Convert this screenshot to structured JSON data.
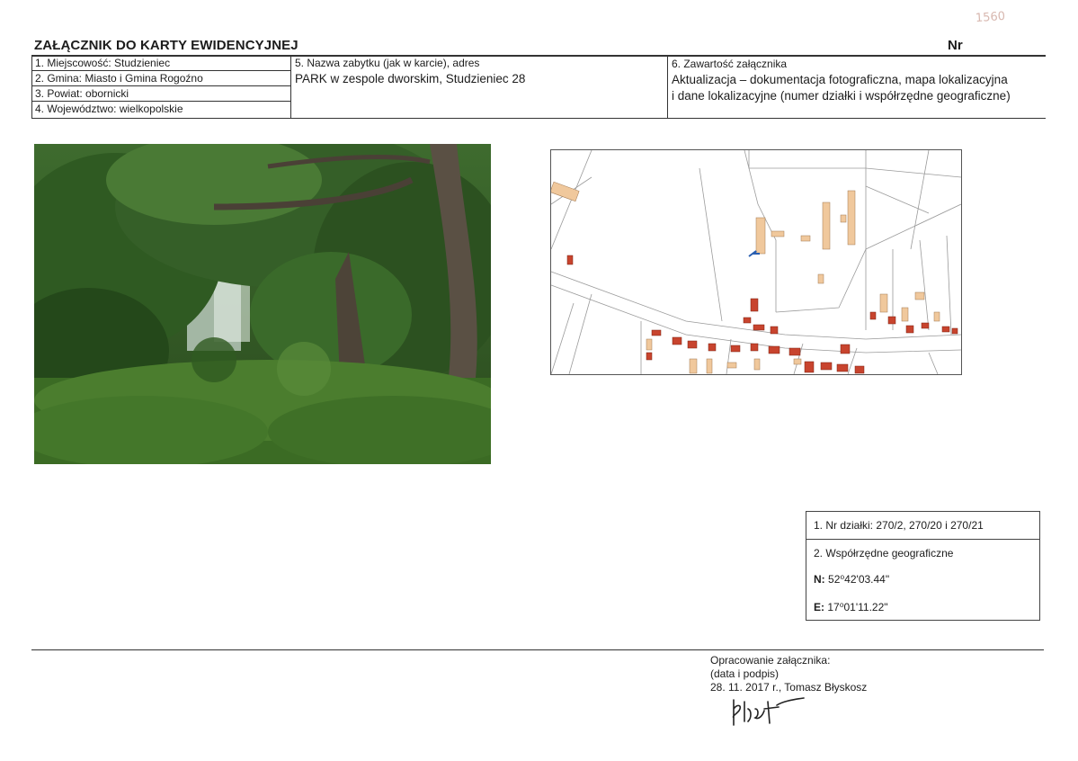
{
  "header": {
    "title": "ZAŁĄCZNIK DO KARTY EWIDENCYJNEJ",
    "nr_label": "Nr",
    "pencil_note": "1560"
  },
  "fields": {
    "miejscowosc": "1. Miejscowość: Studzieniec",
    "gmina": "2. Gmina: Miasto i Gmina Rogoźno",
    "powiat": "3. Powiat: obornicki",
    "wojewodztwo": "4. Województwo: wielkopolskie",
    "nazwa_label": "5. Nazwa zabytku (jak w karcie), adres",
    "nazwa_value": "PARK w zespole dworskim, Studzieniec 28",
    "zawartosc_label": "6. Zawartość załącznika",
    "zawartosc_line1": "Aktualizacja – dokumentacja fotograficzna, mapa lokalizacyjna",
    "zawartosc_line2": "i dane lokalizacyjne (numer działki i współrzędne geograficzne)"
  },
  "location": {
    "dzialki": "1. Nr działki: 270/2, 270/20 i 270/21",
    "wspolrzedne_label": "2. Współrzędne geograficzne",
    "n_label": "N:",
    "n_value": "52⁰42'03.44\"",
    "e_label": "E:",
    "e_value": "17⁰01'11.22\""
  },
  "footer": {
    "line1": "Opracowanie załącznika:",
    "line2": "(data i podpis)",
    "line3": "28. 11. 2017 r., Tomasz Błyskosz"
  },
  "colors": {
    "building_existing": "#f0c89c",
    "building_new": "#c8442e",
    "marker": "#2a5fb0"
  }
}
